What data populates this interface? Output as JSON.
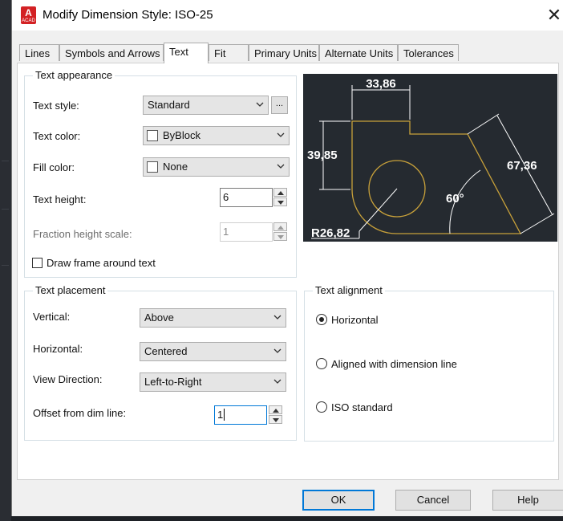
{
  "window": {
    "title": "Modify Dimension Style: ISO-25",
    "app_icon_letter": "A",
    "app_icon_sub": "ACAD",
    "close_glyph": "✕"
  },
  "tabs": [
    {
      "label": "Lines",
      "active": false
    },
    {
      "label": "Symbols and Arrows",
      "active": false
    },
    {
      "label": "Text",
      "active": true
    },
    {
      "label": "Fit",
      "active": false
    },
    {
      "label": "Primary Units",
      "active": false
    },
    {
      "label": "Alternate Units",
      "active": false
    },
    {
      "label": "Tolerances",
      "active": false
    }
  ],
  "text_appearance": {
    "group_title": "Text appearance",
    "text_style": {
      "label": "Text style:",
      "value": "Standard",
      "browse_label": "..."
    },
    "text_color": {
      "label": "Text color:",
      "value": "ByBlock",
      "swatch_color": "#ffffff"
    },
    "fill_color": {
      "label": "Fill color:",
      "value": "None",
      "swatch_color": "#ffffff"
    },
    "text_height": {
      "label": "Text height:",
      "value": "6"
    },
    "fraction_height_scale": {
      "label": "Fraction height scale:",
      "value": "1",
      "enabled": false
    },
    "draw_frame": {
      "label": "Draw frame around text",
      "checked": false
    }
  },
  "preview": {
    "background": "#252a30",
    "shape_color": "#c8a13a",
    "dimension_color": "#ffffff",
    "labels": {
      "top": "33,86",
      "left": "39,85",
      "right": "67,36",
      "angle": "60°",
      "radius": "R26,82"
    }
  },
  "text_placement": {
    "group_title": "Text placement",
    "vertical": {
      "label": "Vertical:",
      "value": "Above"
    },
    "horizontal": {
      "label": "Horizontal:",
      "value": "Centered"
    },
    "view_direction": {
      "label": "View Direction:",
      "value": "Left-to-Right"
    },
    "offset_from_dim_line": {
      "label": "Offset from dim line:",
      "value": "1"
    }
  },
  "text_alignment": {
    "group_title": "Text alignment",
    "options": [
      {
        "label": "Horizontal",
        "selected": true
      },
      {
        "label": "Aligned with dimension line",
        "selected": false
      },
      {
        "label": "ISO standard",
        "selected": false
      }
    ]
  },
  "buttons": {
    "ok": "OK",
    "cancel": "Cancel",
    "help": "Help"
  },
  "icons": {
    "dropdown": "chevron-down-icon",
    "spin_up": "triangle-up-icon",
    "spin_down": "triangle-down-icon",
    "close": "close-icon"
  }
}
